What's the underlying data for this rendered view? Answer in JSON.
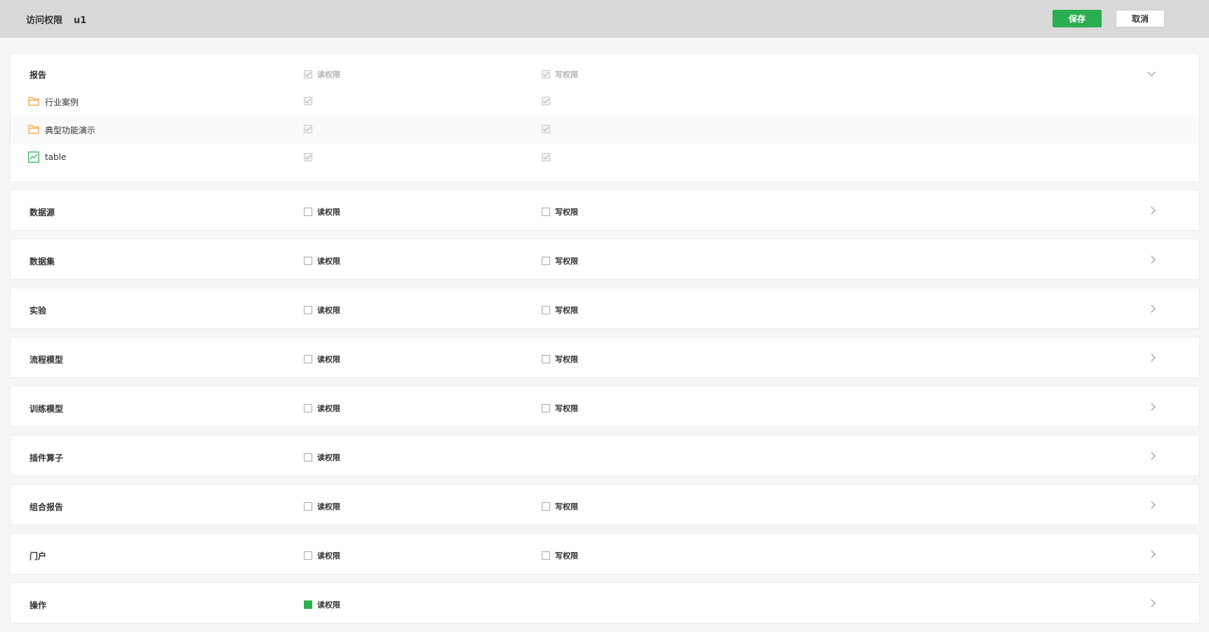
{
  "header": {
    "title": "访问权限",
    "user": "u1",
    "save_label": "保存",
    "cancel_label": "取消"
  },
  "colors": {
    "accent": "#2aae4f",
    "folder": "#f0a43a"
  },
  "report": {
    "name": "报告",
    "read_label": "读权限",
    "write_label": "写权限",
    "read_checked": true,
    "write_checked": true,
    "disabled": true,
    "expanded": true,
    "children": [
      {
        "name": "行业案例",
        "icon": "folder-icon",
        "read_checked": true,
        "write_checked": true
      },
      {
        "name": "典型功能演示",
        "icon": "folder-icon",
        "read_checked": true,
        "write_checked": true
      },
      {
        "name": "table",
        "icon": "chart-icon",
        "read_checked": true,
        "write_checked": true
      }
    ]
  },
  "categories": [
    {
      "name": "数据源",
      "read_label": "读权限",
      "write_label": "写权限",
      "read_checked": false,
      "write_checked": false
    },
    {
      "name": "数据集",
      "read_label": "读权限",
      "write_label": "写权限",
      "read_checked": false,
      "write_checked": false
    },
    {
      "name": "实验",
      "read_label": "读权限",
      "write_label": "写权限",
      "read_checked": false,
      "write_checked": false
    },
    {
      "name": "流程模型",
      "read_label": "读权限",
      "write_label": "写权限",
      "read_checked": false,
      "write_checked": false
    },
    {
      "name": "训练模型",
      "read_label": "读权限",
      "write_label": "写权限",
      "read_checked": false,
      "write_checked": false
    },
    {
      "name": "插件算子",
      "read_label": "读权限",
      "read_checked": false
    },
    {
      "name": "组合报告",
      "read_label": "读权限",
      "write_label": "写权限",
      "read_checked": false,
      "write_checked": false
    },
    {
      "name": "门户",
      "read_label": "读权限",
      "write_label": "写权限",
      "read_checked": false,
      "write_checked": false
    },
    {
      "name": "操作",
      "read_label": "读权限",
      "read_checked": "partial"
    }
  ]
}
